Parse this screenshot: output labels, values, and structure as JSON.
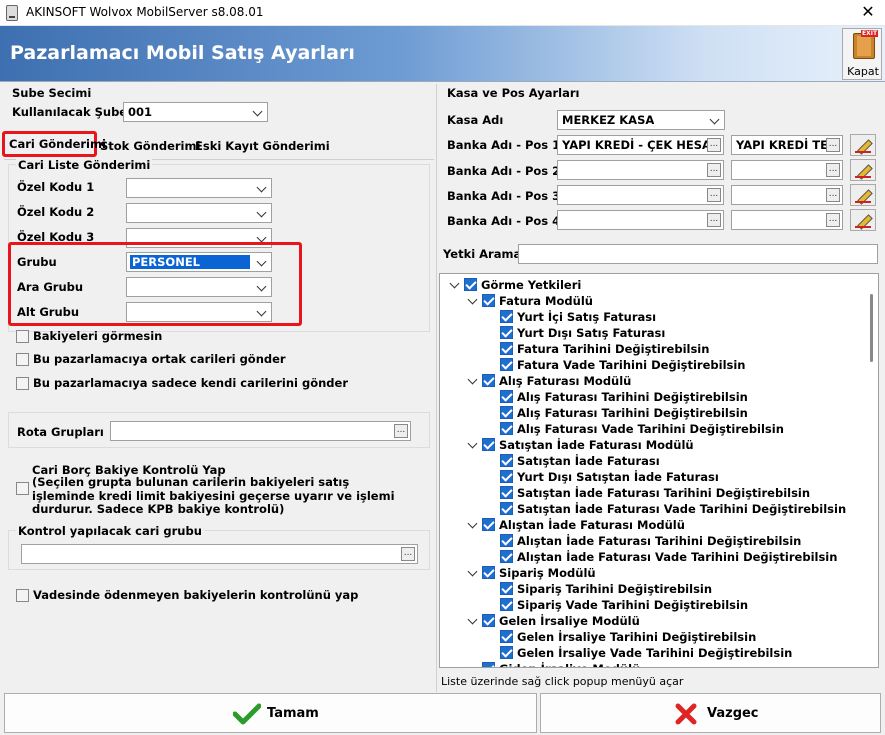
{
  "window": {
    "title": "AKINSOFT Wolvox MobilServer s8.08.01",
    "close_glyph": "✕"
  },
  "banner": {
    "title": "Pazarlamacı Mobil Satış Ayarları",
    "close_label": "Kapat",
    "exit_badge": "EXIT"
  },
  "sube": {
    "header": "Sube Secimi",
    "label": "Kullanılacak Şube",
    "value": "001"
  },
  "tabs": [
    {
      "label": "Cari Gönderimi",
      "active": true
    },
    {
      "label": "Stok Gönderimi"
    },
    {
      "label": "Eski Kayıt Gönderimi"
    }
  ],
  "cari": {
    "group_header": "Cari Liste Gönderimi",
    "fields": [
      {
        "label": "Özel Kodu 1",
        "value": ""
      },
      {
        "label": "Özel Kodu 2",
        "value": ""
      },
      {
        "label": "Özel Kodu 3",
        "value": ""
      },
      {
        "label": "Grubu",
        "value": "PERSONEL"
      },
      {
        "label": "Ara Grubu",
        "value": ""
      },
      {
        "label": "Alt Grubu",
        "value": ""
      }
    ],
    "checks": [
      "Bakiyeleri görmesin",
      "Bu pazarlamacıya ortak carileri gönder",
      "Bu pazarlamacıya sadece kendi carilerini gönder"
    ],
    "rota_label": "Rota Grupları",
    "borc_title": "Cari Borç Bakiye Kontrolü Yap",
    "borc_desc": "(Seçilen grupta bulunan carilerin bakiyeleri satış işleminde kredi limit bakiyesini geçerse uyarır ve işlemi durdurur. Sadece KPB bakiye kontrolü)",
    "kontrol_label": "Kontrol yapılacak cari grubu",
    "vade_label": "Vadesinde ödenmeyen bakiyelerin kontrolünü yap"
  },
  "kasa": {
    "header": "Kasa ve Pos Ayarları",
    "kasa_label": "Kasa Adı",
    "kasa_value": "MERKEZ KASA",
    "pos": [
      {
        "label": "Banka Adı - Pos 1",
        "value1": "YAPI KREDİ - ÇEK HESA",
        "value2": "YAPI KREDİ TE"
      },
      {
        "label": "Banka Adı - Pos 2",
        "value1": "",
        "value2": ""
      },
      {
        "label": "Banka Adı - Pos 3",
        "value1": "",
        "value2": ""
      },
      {
        "label": "Banka Adı - Pos 4",
        "value1": "",
        "value2": ""
      }
    ],
    "yetki_label": "Yetki Arama",
    "ellipsis": "..."
  },
  "tree": [
    {
      "level": 0,
      "label": "Görme Yetkileri",
      "expand": true
    },
    {
      "level": 1,
      "label": "Fatura Modülü",
      "expand": true
    },
    {
      "level": 2,
      "label": "Yurt İçi Satış Faturası"
    },
    {
      "level": 2,
      "label": "Yurt Dışı Satış Faturası"
    },
    {
      "level": 2,
      "label": "Fatura Tarihini Değiştirebilsin"
    },
    {
      "level": 2,
      "label": "Fatura Vade Tarihini Değiştirebilsin"
    },
    {
      "level": 1,
      "label": "Alış Faturası Modülü",
      "expand": true
    },
    {
      "level": 2,
      "label": "Alış Faturası Tarihini Değiştirebilsin"
    },
    {
      "level": 2,
      "label": "Alış Faturası Tarihini Değiştirebilsin"
    },
    {
      "level": 2,
      "label": "Alış Faturası Vade Tarihini Değiştirebilsin"
    },
    {
      "level": 1,
      "label": "Satıştan İade Faturası Modülü",
      "expand": true
    },
    {
      "level": 2,
      "label": "Satıştan İade Faturası"
    },
    {
      "level": 2,
      "label": "Yurt Dışı Satıştan İade Faturası"
    },
    {
      "level": 2,
      "label": "Satıştan İade Faturası Tarihini Değiştirebilsin"
    },
    {
      "level": 2,
      "label": "Satıştan İade Faturası Vade Tarihini Değiştirebilsin"
    },
    {
      "level": 1,
      "label": "Alıştan İade Faturası Modülü",
      "expand": true
    },
    {
      "level": 2,
      "label": "Alıştan İade Faturası Tarihini Değiştirebilsin"
    },
    {
      "level": 2,
      "label": "Alıştan İade Faturası Vade Tarihini Değiştirebilsin"
    },
    {
      "level": 1,
      "label": "Sipariş Modülü",
      "expand": true
    },
    {
      "level": 2,
      "label": "Sipariş Tarihini Değiştirebilsin"
    },
    {
      "level": 2,
      "label": "Sipariş Vade Tarihini Değiştirebilsin"
    },
    {
      "level": 1,
      "label": "Gelen İrsaliye Modülü",
      "expand": true
    },
    {
      "level": 2,
      "label": "Gelen İrsaliye Tarihini Değiştirebilsin"
    },
    {
      "level": 2,
      "label": "Gelen İrsaliye Vade Tarihini Değiştirebilsin"
    },
    {
      "level": 1,
      "label": "Giden İrsaliye Modülü",
      "expand": true
    }
  ],
  "tree_hint": "Liste üzerinde sağ click popup menüyü açar",
  "buttons": {
    "ok": "Tamam",
    "cancel": "Vazgec"
  }
}
